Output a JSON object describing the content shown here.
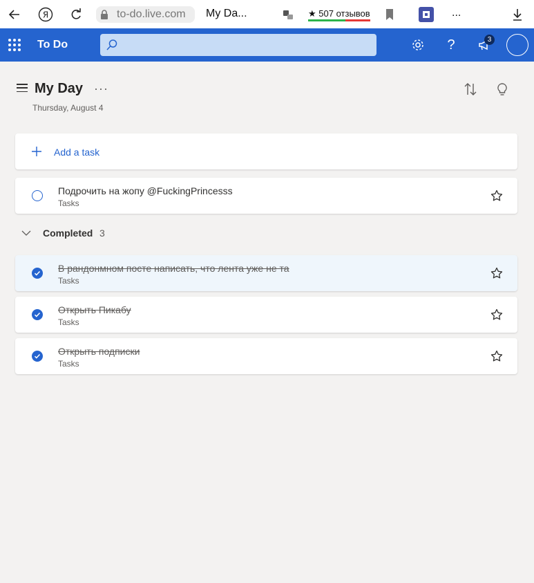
{
  "browser": {
    "url": "to-do.live.com",
    "tab_title": "My Da...",
    "reviews": "507 отзывов",
    "ellipsis": "..."
  },
  "app": {
    "name": "To Do",
    "search_placeholder": "",
    "notification_count": "3",
    "accent": "#2564cf"
  },
  "page": {
    "title": "My Day",
    "more": "···",
    "date": "Thursday, August 4"
  },
  "add_task": {
    "label": "Add a task"
  },
  "tasks": [
    {
      "title": "Подрочить на жопу @FuckingPrincesss",
      "list": "Tasks",
      "completed": false
    }
  ],
  "completed": {
    "label": "Completed",
    "count": "3",
    "items": [
      {
        "title": "В рандонмном посте написать, что лента уже не та",
        "list": "Tasks",
        "completed": true
      },
      {
        "title": "Открыть Пикабу",
        "list": "Tasks",
        "completed": true
      },
      {
        "title": "Открыть подписки",
        "list": "Tasks",
        "completed": true
      }
    ]
  }
}
